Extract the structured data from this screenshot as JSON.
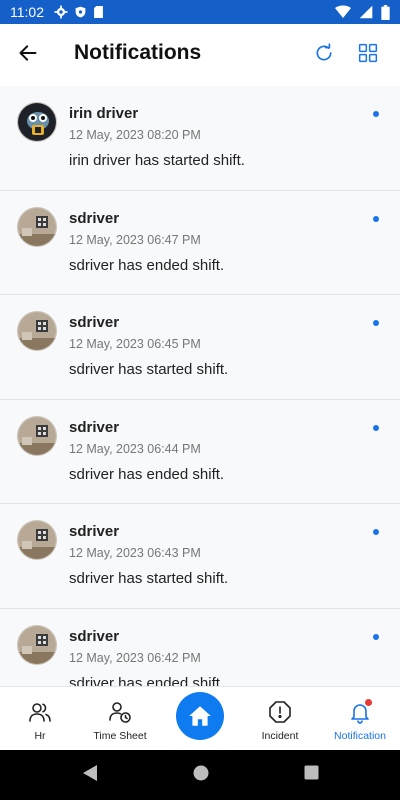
{
  "status_bar": {
    "time": "11:02",
    "icons": [
      "gear-icon",
      "shield-icon",
      "sd-card-icon"
    ],
    "right_icons": [
      "wifi-icon",
      "signal-icon",
      "battery-icon"
    ]
  },
  "header": {
    "title": "Notifications",
    "back_icon": "arrow-left-icon",
    "refresh_icon": "refresh-icon",
    "grid_icon": "grid-icon"
  },
  "notifications": [
    {
      "name": "irin driver",
      "date": "12 May, 2023 08:20 PM",
      "message": "irin driver has started shift.",
      "avatar": "cartoon-avatar",
      "unread": true
    },
    {
      "name": "sdriver",
      "date": "12 May, 2023 06:47 PM",
      "message": "sdriver has ended shift.",
      "avatar": "room-photo-avatar",
      "unread": true
    },
    {
      "name": "sdriver",
      "date": "12 May, 2023 06:45 PM",
      "message": "sdriver has started shift.",
      "avatar": "room-photo-avatar",
      "unread": true
    },
    {
      "name": "sdriver",
      "date": "12 May, 2023 06:44 PM",
      "message": "sdriver has ended shift.",
      "avatar": "room-photo-avatar",
      "unread": true
    },
    {
      "name": "sdriver",
      "date": "12 May, 2023 06:43 PM",
      "message": "sdriver has started shift.",
      "avatar": "room-photo-avatar",
      "unread": true
    },
    {
      "name": "sdriver",
      "date": "12 May, 2023 06:42 PM",
      "message": "sdriver has ended shift.",
      "avatar": "room-photo-avatar",
      "unread": true
    }
  ],
  "bottom_nav": {
    "items": [
      {
        "label": "Hr",
        "icon": "users-icon"
      },
      {
        "label": "Time Sheet",
        "icon": "user-clock-icon"
      },
      {
        "label": "",
        "icon": "home-icon"
      },
      {
        "label": "Incident",
        "icon": "alert-octagon-icon"
      },
      {
        "label": "Notification",
        "icon": "bell-icon"
      }
    ],
    "active": "Notification"
  },
  "colors": {
    "status_bar": "#1560C8",
    "accent": "#1a73e8",
    "home_button": "#0f7bf0",
    "badge": "#e53935"
  }
}
